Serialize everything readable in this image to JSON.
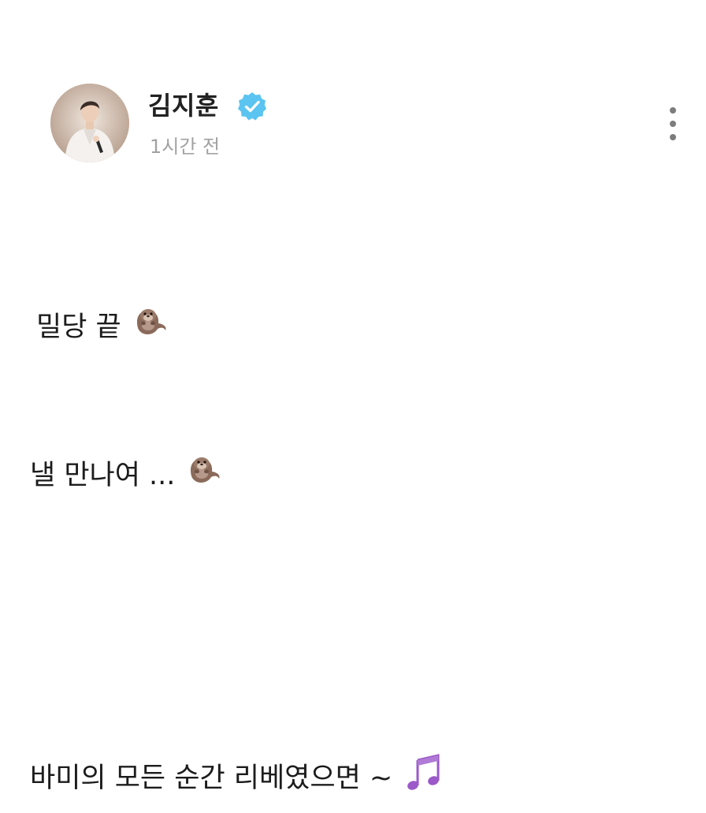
{
  "post": {
    "author": {
      "name": "김지훈",
      "verified": true,
      "timestamp": "1시간 전"
    },
    "lines": [
      {
        "text": "밀당 끝",
        "emoji": "otter"
      },
      {
        "text": "낼 만나여 ...",
        "emoji": "otter"
      },
      {
        "text": "바미의 모든 순간 리베였으면 ~",
        "emoji": "musical-notes"
      }
    ]
  },
  "colors": {
    "verified_badge": "#5bc4f0",
    "timestamp": "#a2a2a2",
    "text": "#1c1c1c",
    "notes": "#9b59c9"
  }
}
